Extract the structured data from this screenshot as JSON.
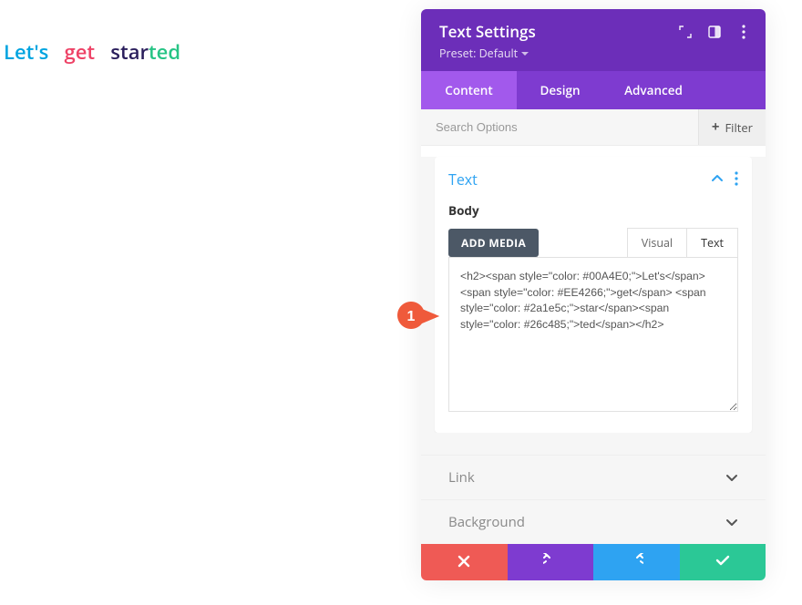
{
  "preview": {
    "parts": [
      "Let's",
      "get",
      "star",
      "ted"
    ]
  },
  "colors": {
    "part1": "#00A4E0",
    "part2": "#EE4266",
    "part3": "#2a1e5c",
    "part4": "#26c485",
    "header_bg": "#6c2eb9",
    "tab_active": "#a259ec",
    "accent_blue": "#2ea3f2"
  },
  "header": {
    "title": "Text Settings",
    "preset_label": "Preset: Default"
  },
  "tabs": {
    "content": "Content",
    "design": "Design",
    "advanced": "Advanced",
    "active": "Content"
  },
  "search": {
    "placeholder": "Search Options",
    "filter_label": "Filter"
  },
  "text_section": {
    "title": "Text",
    "body_label": "Body",
    "add_media_label": "ADD MEDIA",
    "editor_tabs": {
      "visual": "Visual",
      "text": "Text",
      "active": "Text"
    },
    "code_value": "<h2><span style=\"color: #00A4E0;\">Let's</span> <span style=\"color: #EE4266;\">get</span> <span style=\"color: #2a1e5c;\">star</span><span style=\"color: #26c485;\">ted</span></h2>"
  },
  "collapsed_sections": {
    "link": "Link",
    "background": "Background"
  },
  "callout": {
    "number": "1"
  }
}
